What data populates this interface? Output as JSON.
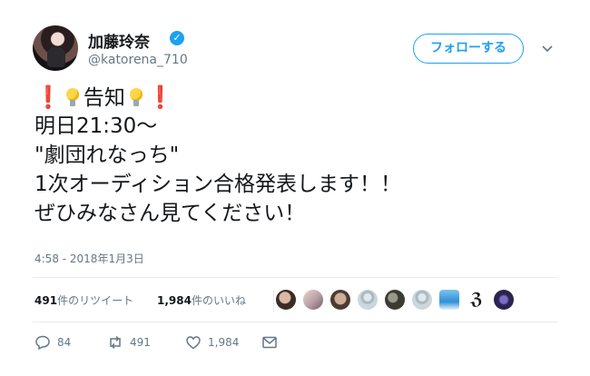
{
  "author": {
    "name": "加藤玲奈",
    "handle": "@katorena_710"
  },
  "follow_button": "フォローする",
  "tweet": {
    "line1_text": "告知",
    "line2": "明日21:30～",
    "line3": "\"劇団れなっち\"",
    "line4": "1次オーディション合格発表します！！",
    "line5": "ぜひみなさん見てください！",
    "emoji": {
      "exclamation": "❗",
      "bulb_icon": "light-bulb-icon"
    }
  },
  "timestamp": "4:58 - 2018年1月3日",
  "stats": {
    "retweets_count": "491",
    "retweets_label": "件のリツイート",
    "likes_count": "1,984",
    "likes_label": "件のいいね"
  },
  "actions": {
    "reply_count": "84",
    "retweet_count": "491",
    "like_count": "1,984"
  },
  "colors": {
    "accent": "#1da1f2",
    "text": "#14171a",
    "muted": "#657786",
    "exclamation": "#d21f3c"
  }
}
